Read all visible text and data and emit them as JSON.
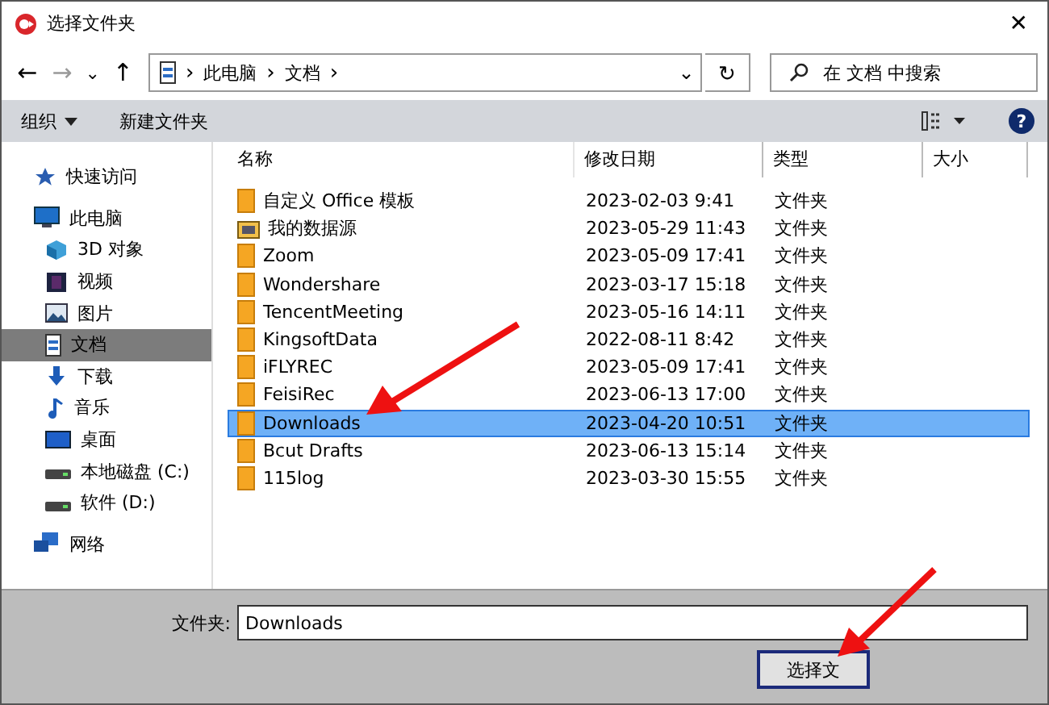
{
  "window": {
    "title": "选择文件夹",
    "close": "✕"
  },
  "nav": {
    "back": "←",
    "forward": "→",
    "recent": "⌄",
    "up": "↑",
    "path": [
      {
        "label": "此电脑"
      },
      {
        "label": "文档"
      }
    ],
    "separator": "›",
    "dropdown": "⌄",
    "refresh": "↻",
    "search": {
      "placeholder": "在 文档 中搜索"
    }
  },
  "toolbar": {
    "organize": "组织",
    "new_folder": "新建文件夹",
    "help": "?"
  },
  "sidebar": {
    "items": [
      {
        "label": "快速访问",
        "kind": "star",
        "selected": false
      },
      {
        "label": "此电脑",
        "kind": "monitor",
        "selected": false,
        "children": [
          {
            "label": "3D 对象",
            "kind": "cube",
            "selected": false
          },
          {
            "label": "视频",
            "kind": "film",
            "selected": false
          },
          {
            "label": "图片",
            "kind": "image",
            "selected": false
          },
          {
            "label": "文档",
            "kind": "doc",
            "selected": true
          },
          {
            "label": "下载",
            "kind": "download",
            "selected": false
          },
          {
            "label": "音乐",
            "kind": "note",
            "selected": false
          },
          {
            "label": "桌面",
            "kind": "desktop",
            "selected": false
          },
          {
            "label": "本地磁盘 (C:)",
            "kind": "drive",
            "selected": false
          },
          {
            "label": "软件 (D:)",
            "kind": "drive",
            "selected": false
          }
        ]
      },
      {
        "label": "网络",
        "kind": "network",
        "selected": false
      }
    ]
  },
  "table": {
    "columns": [
      "名称",
      "修改日期",
      "类型",
      "大小"
    ],
    "rows": [
      {
        "name": "自定义 Office 模板",
        "date": "2023-02-03 9:41",
        "type": "文件夹",
        "kind": "folder",
        "selected": false
      },
      {
        "name": "我的数据源",
        "date": "2023-05-29 11:43",
        "type": "文件夹",
        "kind": "datasource",
        "selected": false
      },
      {
        "name": "Zoom",
        "date": "2023-05-09 17:41",
        "type": "文件夹",
        "kind": "folder",
        "selected": false
      },
      {
        "name": "Wondershare",
        "date": "2023-03-17 15:18",
        "type": "文件夹",
        "kind": "folder",
        "selected": false
      },
      {
        "name": "TencentMeeting",
        "date": "2023-05-16 14:11",
        "type": "文件夹",
        "kind": "folder",
        "selected": false
      },
      {
        "name": "KingsoftData",
        "date": "2022-08-11 8:42",
        "type": "文件夹",
        "kind": "folder",
        "selected": false
      },
      {
        "name": "iFLYREC",
        "date": "2023-05-09 17:41",
        "type": "文件夹",
        "kind": "folder",
        "selected": false
      },
      {
        "name": "FeisiRec",
        "date": "2023-06-13 17:00",
        "type": "文件夹",
        "kind": "folder",
        "selected": false
      },
      {
        "name": "Downloads",
        "date": "2023-04-20 10:51",
        "type": "文件夹",
        "kind": "folder",
        "selected": true
      },
      {
        "name": "Bcut Drafts",
        "date": "2023-06-13 15:14",
        "type": "文件夹",
        "kind": "folder",
        "selected": false
      },
      {
        "name": "115log",
        "date": "2023-03-30 15:55",
        "type": "文件夹",
        "kind": "folder",
        "selected": false
      }
    ]
  },
  "footer": {
    "label": "文件夹:",
    "value": "Downloads",
    "button": "选择文"
  }
}
